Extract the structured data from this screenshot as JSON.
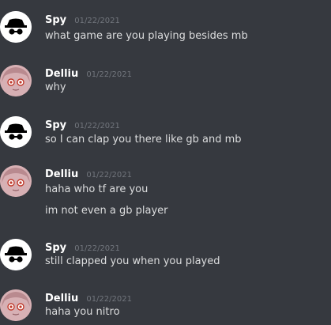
{
  "messages": [
    {
      "author": "Spy",
      "timestamp": "01/22/2021",
      "lines": [
        "what game are you playing besides mb"
      ],
      "avatar": "spy-incognito-icon"
    },
    {
      "author": "Delliu",
      "timestamp": "01/22/2021",
      "lines": [
        "why"
      ],
      "avatar": "anime-girl-avatar"
    },
    {
      "author": "Spy",
      "timestamp": "01/22/2021",
      "lines": [
        "so I can clap you there like gb and mb"
      ],
      "avatar": "spy-incognito-icon"
    },
    {
      "author": "Delliu",
      "timestamp": "01/22/2021",
      "lines": [
        "haha who tf are you",
        "im not even a gb player"
      ],
      "avatar": "anime-girl-avatar"
    },
    {
      "author": "Spy",
      "timestamp": "01/22/2021",
      "lines": [
        "still clapped you when you played"
      ],
      "avatar": "spy-incognito-icon"
    },
    {
      "author": "Delliu",
      "timestamp": "01/22/2021",
      "lines": [
        "haha you nitro"
      ],
      "avatar": "anime-girl-avatar"
    }
  ],
  "colors": {
    "background": "#36393f",
    "username": "#ffffff",
    "text": "#dcddde",
    "timestamp": "#72767d"
  }
}
